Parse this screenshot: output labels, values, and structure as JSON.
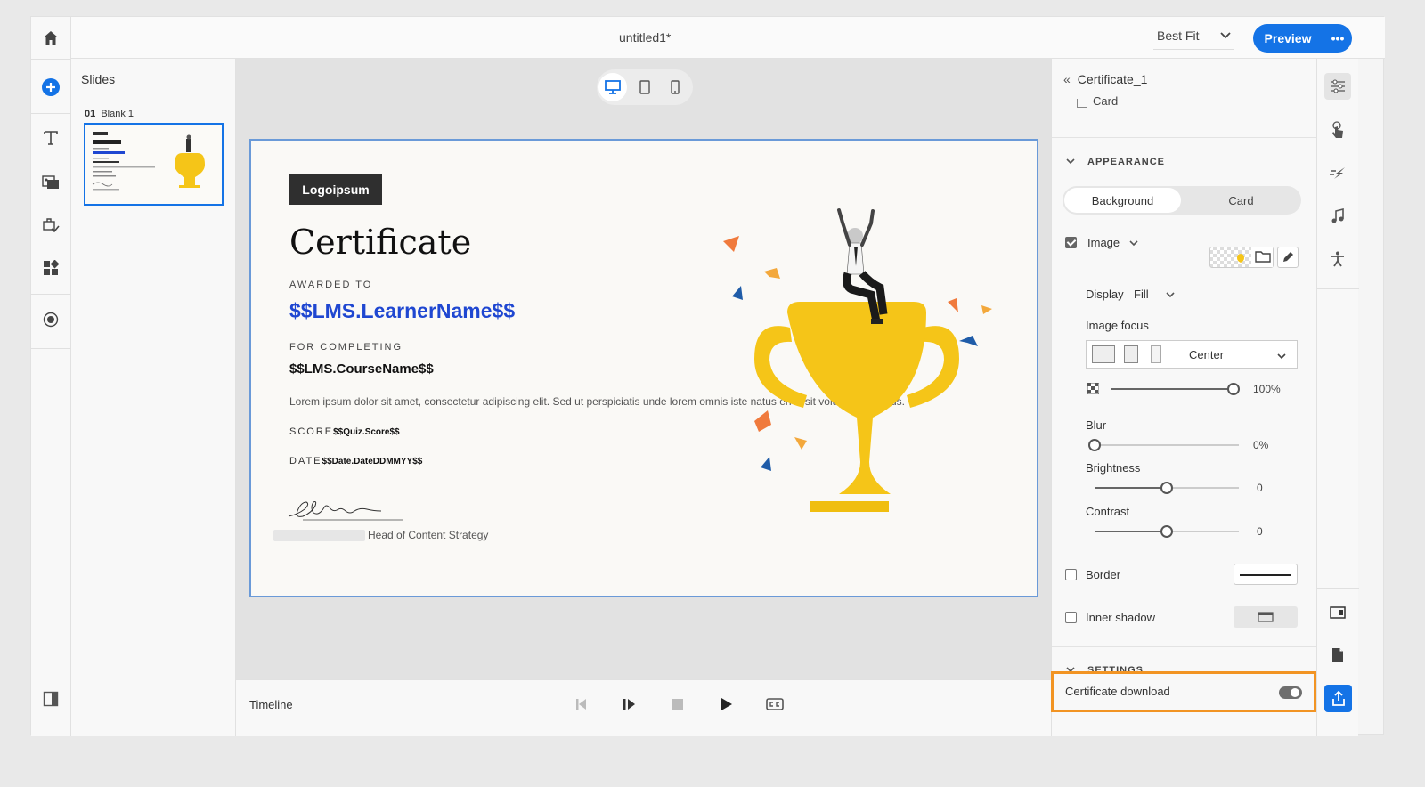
{
  "topbar": {
    "doc_title": "untitled1*",
    "zoom": "Best Fit",
    "preview_label": "Preview",
    "more_label": "•••"
  },
  "slides_panel": {
    "heading": "Slides",
    "slides": [
      {
        "number": "01",
        "name": "Blank 1"
      }
    ]
  },
  "certificate": {
    "logo": "Logoipsum",
    "title": "Certificate",
    "awarded_label": "AWARDED TO",
    "learner": "$$LMS.LearnerName$$",
    "for_completing_label": "FOR COMPLETING",
    "course": "$$LMS.CourseName$$",
    "body": "Lorem ipsum dolor sit amet, consectetur adipiscing elit. Sed ut perspiciatis unde lorem omnis iste natus error sit voluptatem accus.",
    "score_label": "SCORE",
    "score_value": "$$Quiz.Score$$",
    "date_label": "DATE",
    "date_value": "$$Date.DateDDMMYY$$",
    "signatory_title": "Head of Content Strategy"
  },
  "timeline": {
    "label": "Timeline"
  },
  "properties": {
    "header": "Certificate_1",
    "cut_item": "Card",
    "appearance": {
      "title": "APPEARANCE",
      "tabs": [
        "Background",
        "Card"
      ],
      "image_label": "Image",
      "image_checked": true,
      "display_label": "Display",
      "display_value": "Fill",
      "image_focus_label": "Image focus",
      "image_focus_value": "Center",
      "opacity_value": "100%",
      "opacity_level": 1.0,
      "blur_label": "Blur",
      "blur_value": "0%",
      "blur_level": 0.0,
      "brightness_label": "Brightness",
      "brightness_value": "0",
      "brightness_level": 0.5,
      "contrast_label": "Contrast",
      "contrast_value": "0",
      "contrast_level": 0.5,
      "border_label": "Border",
      "inner_shadow_label": "Inner shadow"
    },
    "settings": {
      "title": "SETTINGS",
      "certificate_download_label": "Certificate download",
      "certificate_download_on": true
    }
  },
  "colors": {
    "accent": "#1473e6",
    "highlight": "#f29423",
    "learner": "#1f47d1",
    "trophy": "#f5c518"
  }
}
